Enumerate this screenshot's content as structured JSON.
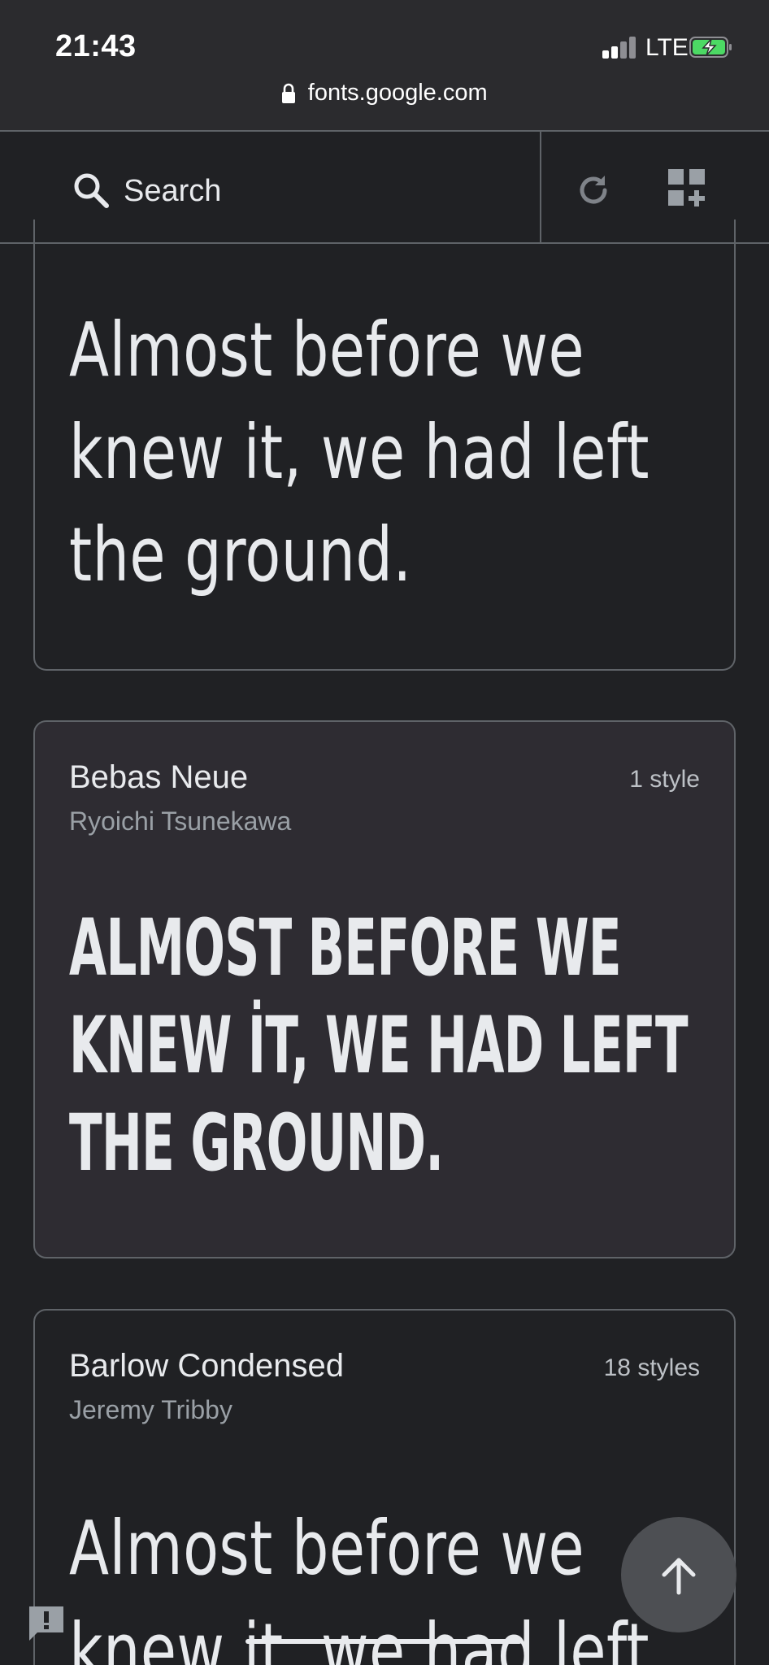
{
  "status_bar": {
    "time": "21:43",
    "network": "LTE",
    "battery_state": "charging",
    "battery_color": "#4cd964"
  },
  "browser": {
    "url": "fonts.google.com"
  },
  "app_bar": {
    "search_label": "Search",
    "icons": [
      "search-icon",
      "refresh-icon",
      "grid-add-icon"
    ]
  },
  "cards": [
    {
      "sample_text": "Almost before we knew it, we had left the ground."
    },
    {
      "family": "Bebas Neue",
      "designer": "Ryoichi Tsunekawa",
      "styles": "1 style",
      "sample_text": "ALMOST BEFORE WE KNEW İT, WE HAD LEFT THE GROUND."
    },
    {
      "family": "Barlow Condensed",
      "designer": "Jeremy Tribby",
      "styles": "18 styles",
      "sample_text": "Almost before we knew it, we had left"
    }
  ],
  "fab": {
    "icon": "arrow-up-icon"
  },
  "feedback": {
    "icon": "feedback-icon"
  },
  "colors": {
    "background": "#202124",
    "card_border": "#5f6368",
    "highlight_card": "#2e2c32",
    "text_primary": "#e8eaed",
    "text_secondary": "#9aa0a6"
  }
}
